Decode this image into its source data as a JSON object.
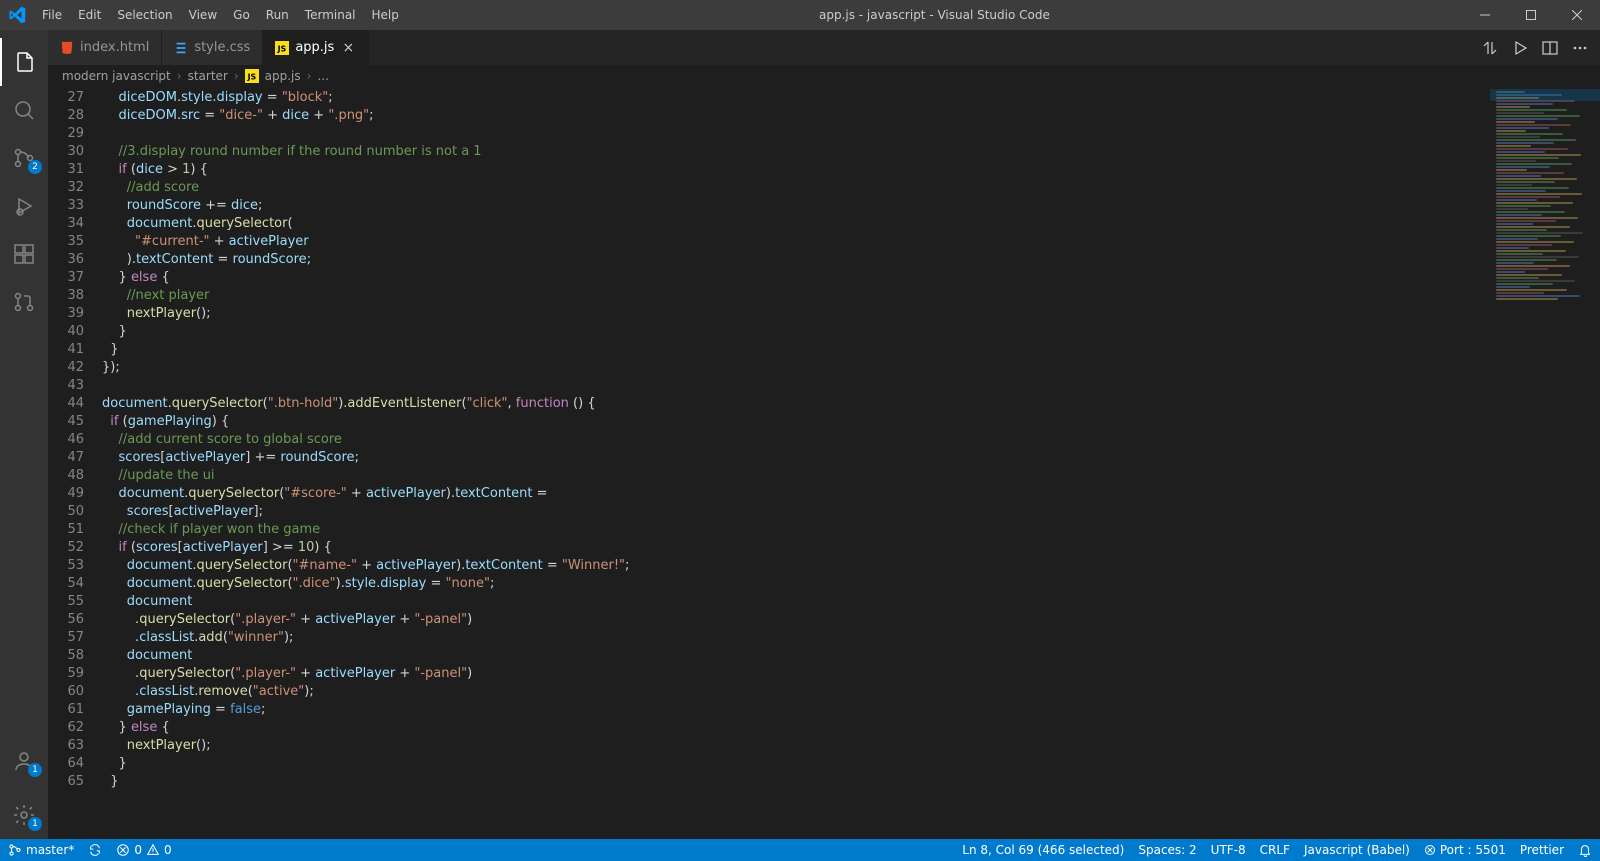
{
  "title": "app.js - javascript - Visual Studio Code",
  "menus": [
    "File",
    "Edit",
    "Selection",
    "View",
    "Go",
    "Run",
    "Terminal",
    "Help"
  ],
  "activity": {
    "scm_badge": "2",
    "account_badge": "1",
    "settings_badge": "1"
  },
  "tabs": [
    {
      "icon": "html",
      "label": "index.html",
      "active": false
    },
    {
      "icon": "css",
      "label": "style.css",
      "active": false
    },
    {
      "icon": "js",
      "label": "app.js",
      "active": true
    }
  ],
  "breadcrumb": [
    "modern javascript",
    "starter",
    "app.js",
    "..."
  ],
  "breadcrumb_icon_at": 2,
  "line_start": 27,
  "statusbar": {
    "branch": "master*",
    "errors": "0",
    "warnings": "0",
    "cursor": "Ln 8, Col 69 (466 selected)",
    "spaces": "Spaces: 2",
    "encoding": "UTF-8",
    "eol": "CRLF",
    "lang": "Javascript (Babel)",
    "port": "Port : 5501",
    "formatter": "Prettier"
  },
  "code": [
    [
      [
        "obj",
        "    diceDOM"
      ],
      [
        "pun",
        "."
      ],
      [
        "obj",
        "style"
      ],
      [
        "pun",
        "."
      ],
      [
        "obj",
        "display"
      ],
      [
        "pun",
        " = "
      ],
      [
        "str",
        "\"block\""
      ],
      [
        "pun",
        ";"
      ]
    ],
    [
      [
        "obj",
        "    diceDOM"
      ],
      [
        "pun",
        "."
      ],
      [
        "obj",
        "src"
      ],
      [
        "pun",
        " = "
      ],
      [
        "str",
        "\"dice-\""
      ],
      [
        "pun",
        " + "
      ],
      [
        "obj",
        "dice"
      ],
      [
        "pun",
        " + "
      ],
      [
        "str",
        "\".png\""
      ],
      [
        "pun",
        ";"
      ]
    ],
    [
      [
        "pun",
        ""
      ]
    ],
    [
      [
        "cmnt",
        "    //3.display round number if the round number is not a 1"
      ]
    ],
    [
      [
        "pun",
        "    "
      ],
      [
        "kw",
        "if"
      ],
      [
        "pun",
        " ("
      ],
      [
        "obj",
        "dice"
      ],
      [
        "pun",
        " > "
      ],
      [
        "num",
        "1"
      ],
      [
        "pun",
        ") {"
      ]
    ],
    [
      [
        "cmnt",
        "      //add score"
      ]
    ],
    [
      [
        "obj",
        "      roundScore"
      ],
      [
        "pun",
        " += "
      ],
      [
        "obj",
        "dice"
      ],
      [
        "pun",
        ";"
      ]
    ],
    [
      [
        "obj",
        "      document"
      ],
      [
        "pun",
        "."
      ],
      [
        "func",
        "querySelector"
      ],
      [
        "pun",
        "("
      ]
    ],
    [
      [
        "str",
        "        \"#current-\""
      ],
      [
        "pun",
        " + "
      ],
      [
        "obj",
        "activePlayer"
      ]
    ],
    [
      [
        "pun",
        "      )."
      ],
      [
        "obj",
        "textContent"
      ],
      [
        "pun",
        " = "
      ],
      [
        "obj",
        "roundScore"
      ],
      [
        "pun",
        ";"
      ]
    ],
    [
      [
        "pun",
        "    } "
      ],
      [
        "kw",
        "else"
      ],
      [
        "pun",
        " {"
      ]
    ],
    [
      [
        "cmnt",
        "      //next player"
      ]
    ],
    [
      [
        "func",
        "      nextPlayer"
      ],
      [
        "pun",
        "();"
      ]
    ],
    [
      [
        "pun",
        "    }"
      ]
    ],
    [
      [
        "pun",
        "  }"
      ]
    ],
    [
      [
        "pun",
        "});"
      ]
    ],
    [
      [
        "pun",
        ""
      ]
    ],
    [
      [
        "obj",
        "document"
      ],
      [
        "pun",
        "."
      ],
      [
        "func",
        "querySelector"
      ],
      [
        "pun",
        "("
      ],
      [
        "str",
        "\".btn-hold\""
      ],
      [
        "pun",
        ")."
      ],
      [
        "func",
        "addEventListener"
      ],
      [
        "pun",
        "("
      ],
      [
        "str",
        "\"click\""
      ],
      [
        "pun",
        ", "
      ],
      [
        "kw",
        "function"
      ],
      [
        "pun",
        " () {"
      ]
    ],
    [
      [
        "pun",
        "  "
      ],
      [
        "kw",
        "if"
      ],
      [
        "pun",
        " ("
      ],
      [
        "obj",
        "gamePlaying"
      ],
      [
        "pun",
        ") {"
      ]
    ],
    [
      [
        "cmnt",
        "    //add current score to global score"
      ]
    ],
    [
      [
        "obj",
        "    scores"
      ],
      [
        "pun",
        "["
      ],
      [
        "obj",
        "activePlayer"
      ],
      [
        "pun",
        "] += "
      ],
      [
        "obj",
        "roundScore"
      ],
      [
        "pun",
        ";"
      ]
    ],
    [
      [
        "cmnt",
        "    //update the ui"
      ]
    ],
    [
      [
        "obj",
        "    document"
      ],
      [
        "pun",
        "."
      ],
      [
        "func",
        "querySelector"
      ],
      [
        "pun",
        "("
      ],
      [
        "str",
        "\"#score-\""
      ],
      [
        "pun",
        " + "
      ],
      [
        "obj",
        "activePlayer"
      ],
      [
        "pun",
        ")."
      ],
      [
        "obj",
        "textContent"
      ],
      [
        "pun",
        " ="
      ]
    ],
    [
      [
        "obj",
        "      scores"
      ],
      [
        "pun",
        "["
      ],
      [
        "obj",
        "activePlayer"
      ],
      [
        "pun",
        "];"
      ]
    ],
    [
      [
        "cmnt",
        "    //check if player won the game"
      ]
    ],
    [
      [
        "pun",
        "    "
      ],
      [
        "kw",
        "if"
      ],
      [
        "pun",
        " ("
      ],
      [
        "obj",
        "scores"
      ],
      [
        "pun",
        "["
      ],
      [
        "obj",
        "activePlayer"
      ],
      [
        "pun",
        "] >= "
      ],
      [
        "num",
        "10"
      ],
      [
        "pun",
        ") {"
      ]
    ],
    [
      [
        "obj",
        "      document"
      ],
      [
        "pun",
        "."
      ],
      [
        "func",
        "querySelector"
      ],
      [
        "pun",
        "("
      ],
      [
        "str",
        "\"#name-\""
      ],
      [
        "pun",
        " + "
      ],
      [
        "obj",
        "activePlayer"
      ],
      [
        "pun",
        ")."
      ],
      [
        "obj",
        "textContent"
      ],
      [
        "pun",
        " = "
      ],
      [
        "str",
        "\"Winner!\""
      ],
      [
        "pun",
        ";"
      ]
    ],
    [
      [
        "obj",
        "      document"
      ],
      [
        "pun",
        "."
      ],
      [
        "func",
        "querySelector"
      ],
      [
        "pun",
        "("
      ],
      [
        "str",
        "\".dice\""
      ],
      [
        "pun",
        ")."
      ],
      [
        "obj",
        "style"
      ],
      [
        "pun",
        "."
      ],
      [
        "obj",
        "display"
      ],
      [
        "pun",
        " = "
      ],
      [
        "str",
        "\"none\""
      ],
      [
        "pun",
        ";"
      ]
    ],
    [
      [
        "obj",
        "      document"
      ]
    ],
    [
      [
        "pun",
        "        ."
      ],
      [
        "func",
        "querySelector"
      ],
      [
        "pun",
        "("
      ],
      [
        "str",
        "\".player-\""
      ],
      [
        "pun",
        " + "
      ],
      [
        "obj",
        "activePlayer"
      ],
      [
        "pun",
        " + "
      ],
      [
        "str",
        "\"-panel\""
      ],
      [
        "pun",
        ")"
      ]
    ],
    [
      [
        "pun",
        "        ."
      ],
      [
        "obj",
        "classList"
      ],
      [
        "pun",
        "."
      ],
      [
        "func",
        "add"
      ],
      [
        "pun",
        "("
      ],
      [
        "str",
        "\"winner\""
      ],
      [
        "pun",
        ");"
      ]
    ],
    [
      [
        "obj",
        "      document"
      ]
    ],
    [
      [
        "pun",
        "        ."
      ],
      [
        "func",
        "querySelector"
      ],
      [
        "pun",
        "("
      ],
      [
        "str",
        "\".player-\""
      ],
      [
        "pun",
        " + "
      ],
      [
        "obj",
        "activePlayer"
      ],
      [
        "pun",
        " + "
      ],
      [
        "str",
        "\"-panel\""
      ],
      [
        "pun",
        ")"
      ]
    ],
    [
      [
        "pun",
        "        ."
      ],
      [
        "obj",
        "classList"
      ],
      [
        "pun",
        "."
      ],
      [
        "func",
        "remove"
      ],
      [
        "pun",
        "("
      ],
      [
        "str",
        "\"active\""
      ],
      [
        "pun",
        ");"
      ]
    ],
    [
      [
        "obj",
        "      gamePlaying"
      ],
      [
        "pun",
        " = "
      ],
      [
        "ctrl",
        "false"
      ],
      [
        "pun",
        ";"
      ]
    ],
    [
      [
        "pun",
        "    } "
      ],
      [
        "kw",
        "else"
      ],
      [
        "pun",
        " {"
      ]
    ],
    [
      [
        "func",
        "      nextPlayer"
      ],
      [
        "pun",
        "();"
      ]
    ],
    [
      [
        "pun",
        "    }"
      ]
    ],
    [
      [
        "pun",
        "  }"
      ]
    ]
  ]
}
